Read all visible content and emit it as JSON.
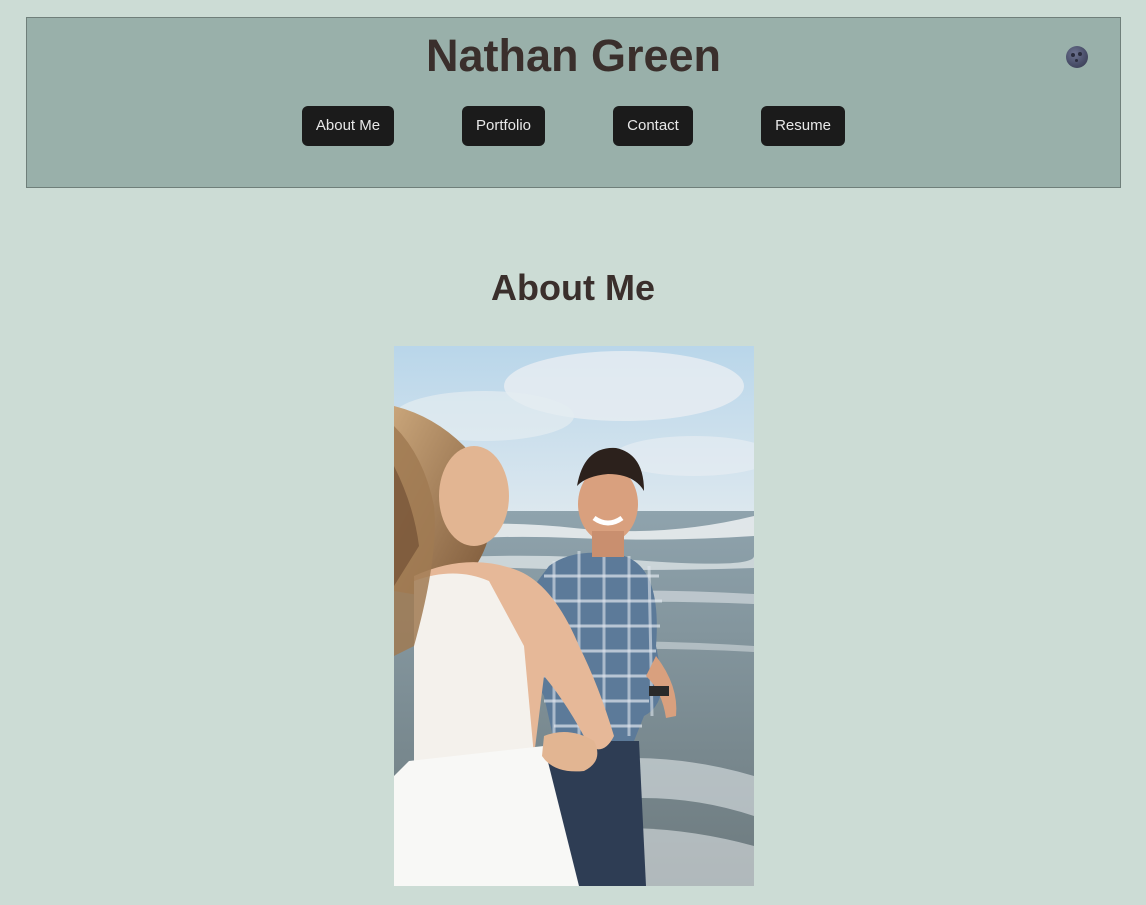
{
  "header": {
    "title": "Nathan Green",
    "theme_toggle_icon": "moon-icon",
    "background_color": "#99b0aa"
  },
  "nav": {
    "items": [
      {
        "label": "About Me"
      },
      {
        "label": "Portfolio"
      },
      {
        "label": "Contact"
      },
      {
        "label": "Resume"
      }
    ]
  },
  "main": {
    "section_title": "About Me",
    "photo": {
      "description_icon": "photo-couple-on-beach"
    }
  },
  "colors": {
    "page_background": "#ccdcd5",
    "button_background": "#1b1b1b",
    "button_text": "#e8e8e8",
    "heading_text": "#3a2f2c"
  }
}
